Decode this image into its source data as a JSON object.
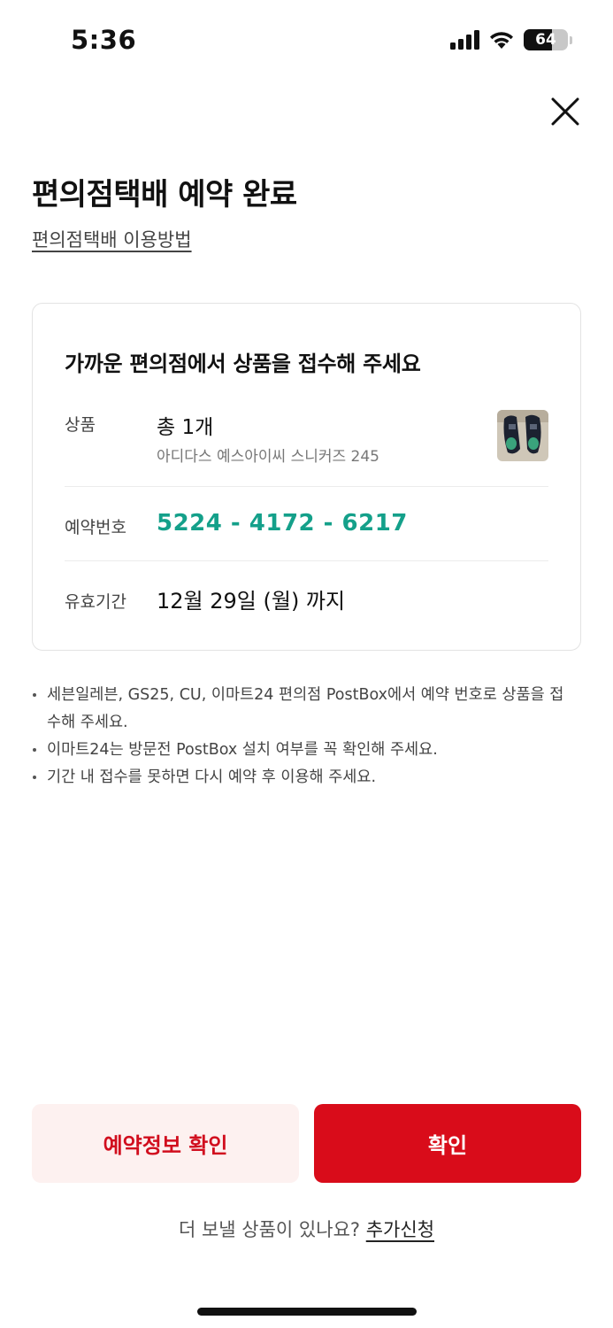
{
  "status_bar": {
    "time": "5:36",
    "battery_level": "64",
    "icons": [
      "signal-icon",
      "wifi-icon",
      "battery-icon"
    ]
  },
  "header": {
    "close_icon": "close-icon",
    "title": "편의점택배 예약 완료",
    "guide_link": "편의점택배 이용방법"
  },
  "card": {
    "heading": "가까운 편의점에서 상품을 접수해 주세요",
    "product": {
      "label": "상품",
      "count": "총 1개",
      "name": "아디다스 예스아이씨 스니커즈 245",
      "thumbnail": "sneaker-thumbnail"
    },
    "reservation": {
      "label": "예약번호",
      "number": "5224 - 4172 - 6217"
    },
    "validity": {
      "label": "유효기간",
      "value": "12월 29일 (월) 까지"
    }
  },
  "notes": [
    "세븐일레븐, GS25, CU, 이마트24 편의점 PostBox에서 예약 번호로 상품을 접수해 주세요.",
    "이마트24는 방문전 PostBox 설치 여부를 꼭 확인해 주세요.",
    "기간 내 접수를 못하면 다시 예약 후 이용해 주세요."
  ],
  "buttons": {
    "reservation_info": "예약정보 확인",
    "confirm": "확인"
  },
  "footer": {
    "question": "더 보낼 상품이 있나요?",
    "add_request": "추가신청"
  },
  "colors": {
    "accent_red": "#d90c1a",
    "accent_red_light": "#fdf1f0",
    "reservation_green": "#14a08a"
  }
}
